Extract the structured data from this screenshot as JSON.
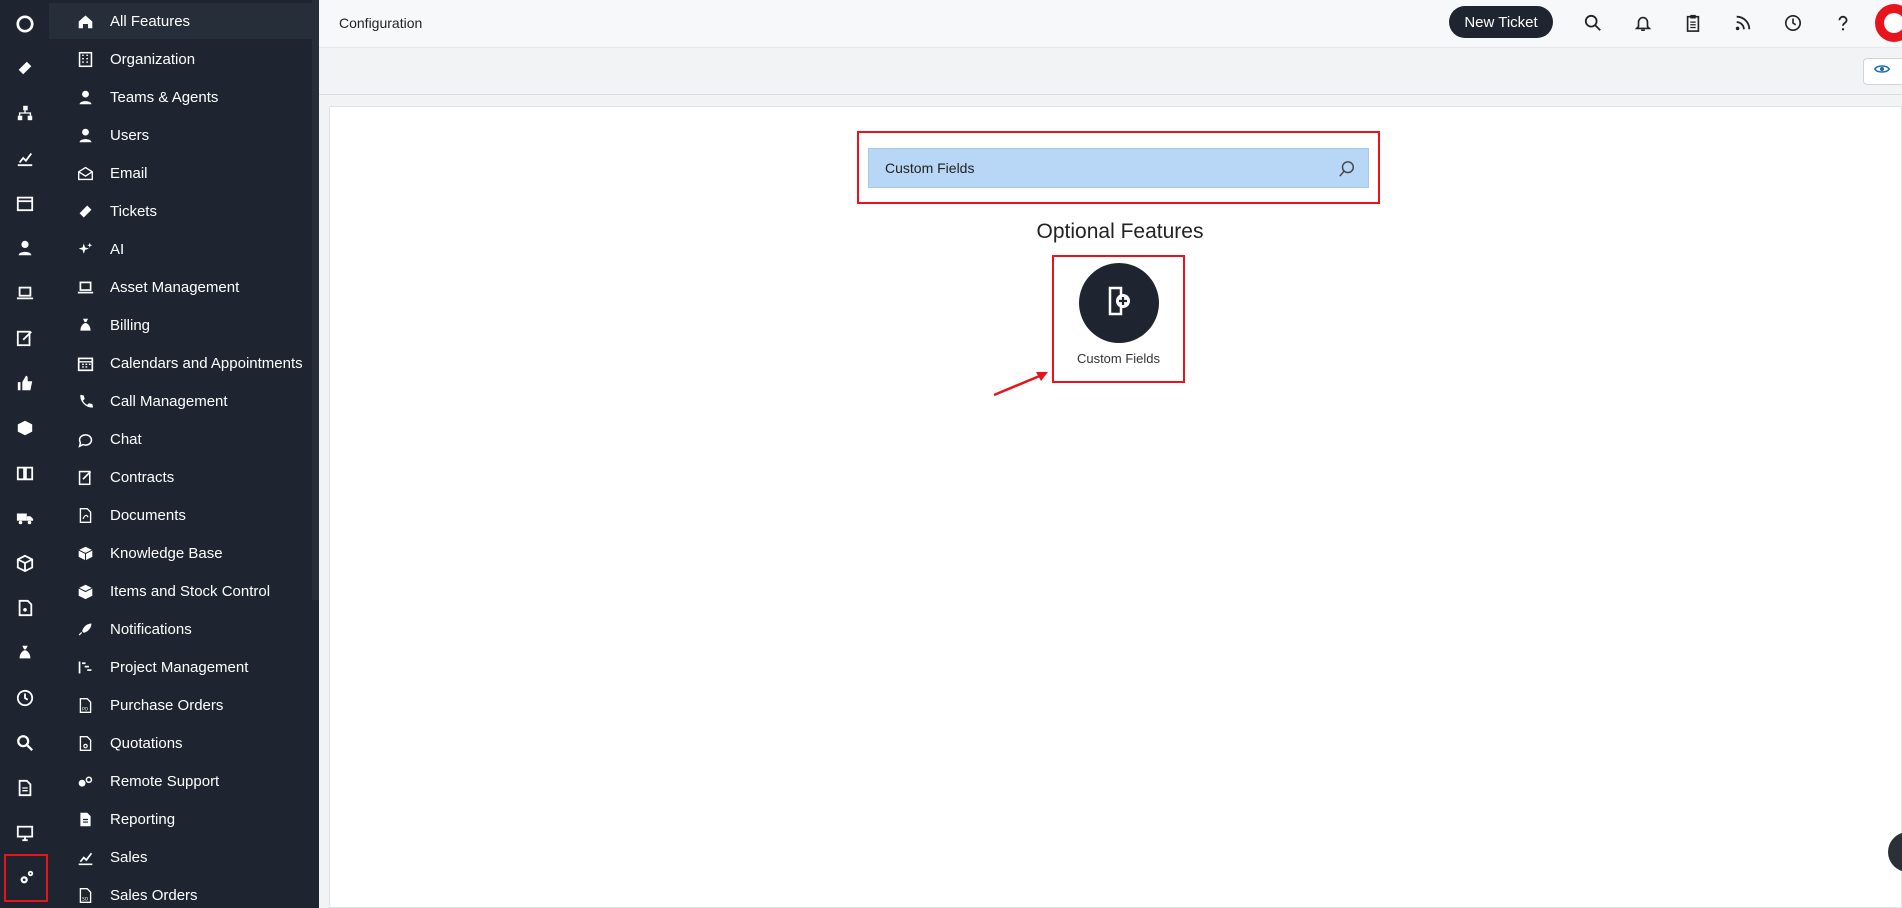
{
  "rail": {
    "icons": [
      "logo-icon",
      "ticket-icon",
      "hierarchy-icon",
      "chart-icon",
      "calendar-icon",
      "user-icon",
      "laptop-icon",
      "edit-icon",
      "thumbs-up-icon",
      "box-icon",
      "book-icon",
      "truck-icon",
      "package-icon",
      "document-money-icon",
      "money-bag-icon",
      "clock-icon",
      "search-icon",
      "file-icon",
      "monitor-icon",
      "gears-icon"
    ]
  },
  "menu": {
    "items": [
      {
        "label": "All Features",
        "icon": "home-icon"
      },
      {
        "label": "Organization",
        "icon": "building-icon"
      },
      {
        "label": "Teams & Agents",
        "icon": "user-icon"
      },
      {
        "label": "Users",
        "icon": "user-icon"
      },
      {
        "label": "Email",
        "icon": "mail-icon"
      },
      {
        "label": "Tickets",
        "icon": "ticket-icon"
      },
      {
        "label": "AI",
        "icon": "sparkle-icon"
      },
      {
        "label": "Asset Management",
        "icon": "laptop-icon"
      },
      {
        "label": "Billing",
        "icon": "money-bag-icon"
      },
      {
        "label": "Calendars and Appointments",
        "icon": "calendar-icon"
      },
      {
        "label": "Call Management",
        "icon": "phone-icon"
      },
      {
        "label": "Chat",
        "icon": "chat-icon"
      },
      {
        "label": "Contracts",
        "icon": "signature-icon"
      },
      {
        "label": "Documents",
        "icon": "pdf-icon"
      },
      {
        "label": "Knowledge Base",
        "icon": "box-icon"
      },
      {
        "label": "Items and Stock Control",
        "icon": "package-icon"
      },
      {
        "label": "Notifications",
        "icon": "rocket-icon"
      },
      {
        "label": "Project Management",
        "icon": "gantt-icon"
      },
      {
        "label": "Purchase Orders",
        "icon": "po-document-icon"
      },
      {
        "label": "Quotations",
        "icon": "quote-document-icon"
      },
      {
        "label": "Remote Support",
        "icon": "remote-icon"
      },
      {
        "label": "Reporting",
        "icon": "report-icon"
      },
      {
        "label": "Sales",
        "icon": "chart-icon"
      },
      {
        "label": "Sales Orders",
        "icon": "so-document-icon"
      }
    ]
  },
  "topbar": {
    "title": "Configuration",
    "new_ticket_label": "New Ticket"
  },
  "search": {
    "value": "Custom Fields"
  },
  "content": {
    "section_title": "Optional Features",
    "features": [
      {
        "label": "Custom Fields",
        "icon": "add-document-icon"
      }
    ]
  },
  "colors": {
    "sidebar_bg": "#1e2530",
    "highlight": "#e8141c",
    "search_bg": "#b8d6f5"
  }
}
